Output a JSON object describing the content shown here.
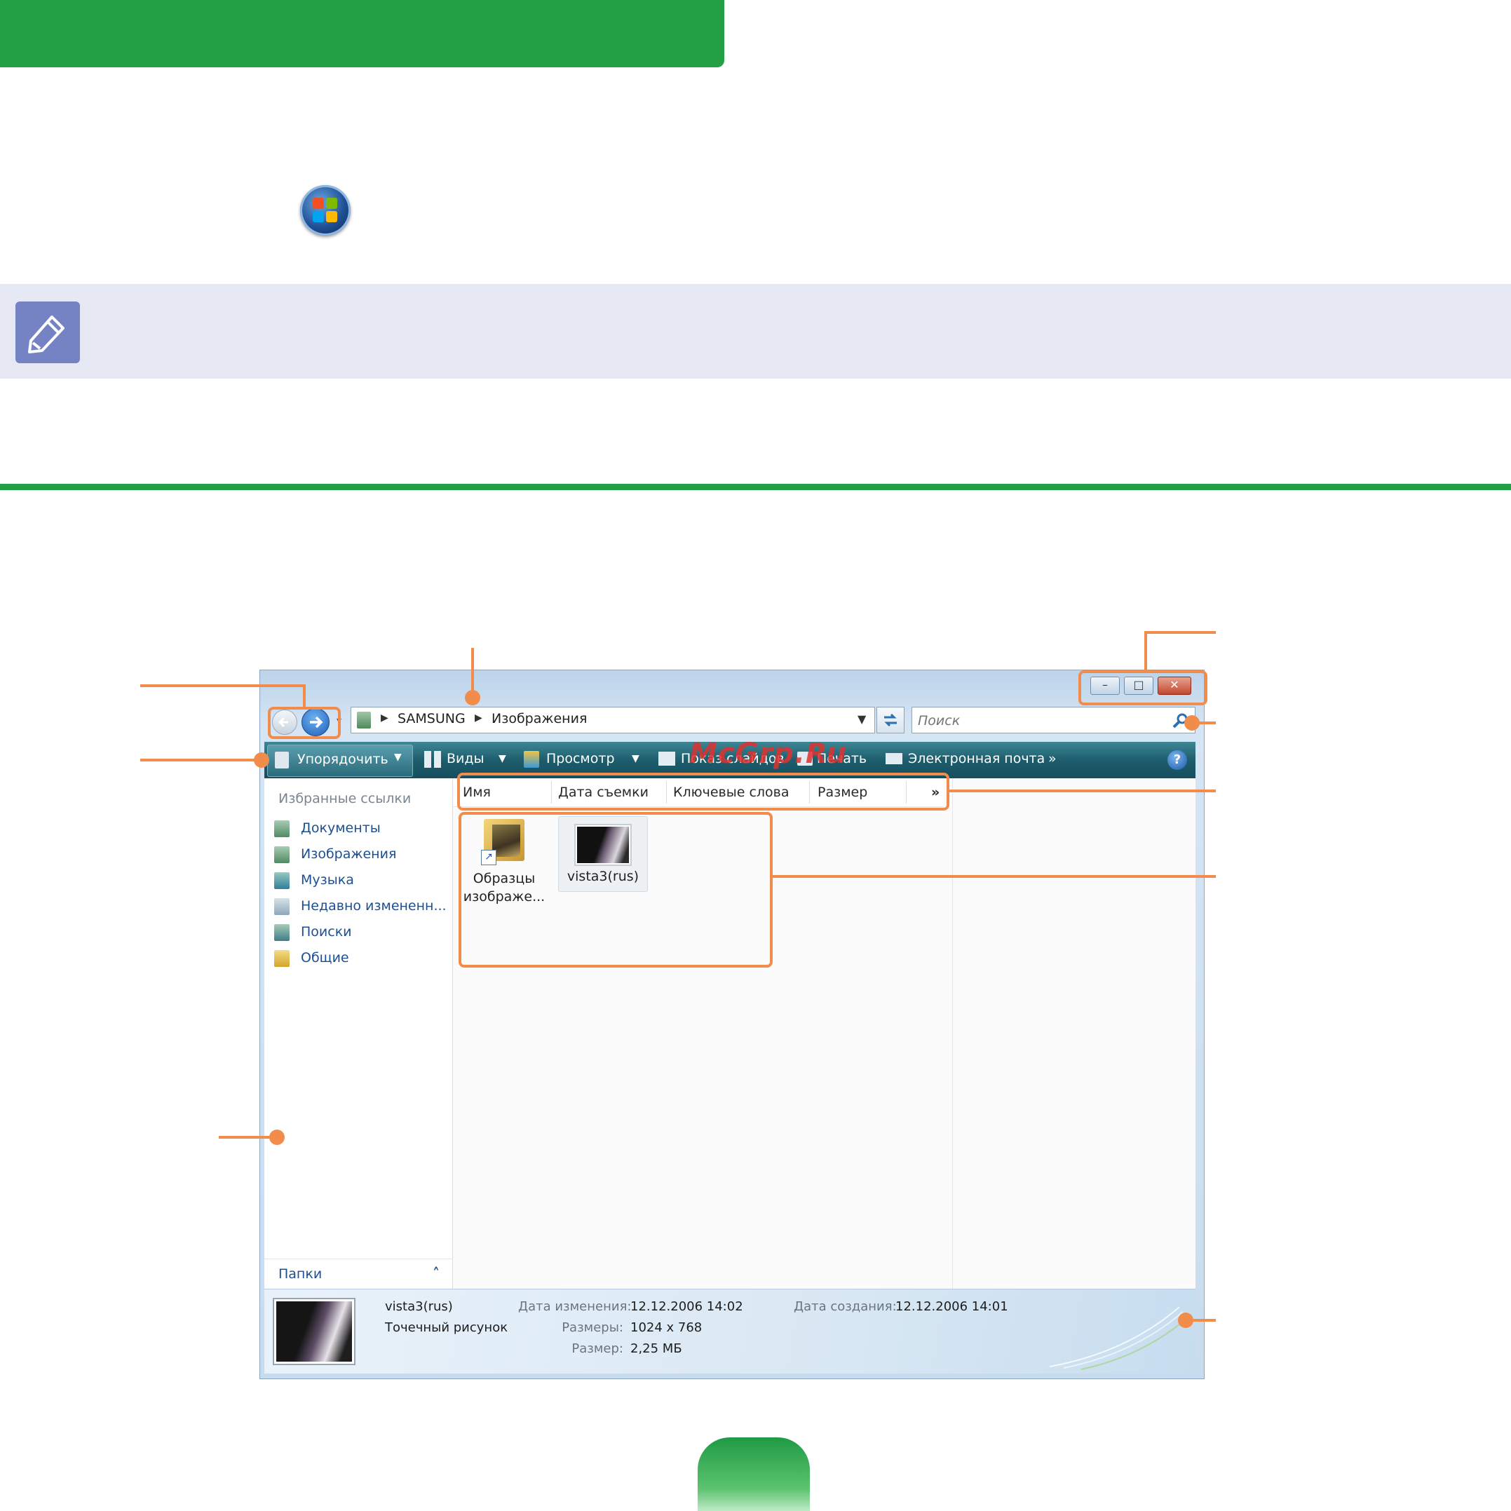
{
  "page": {
    "watermark": "McGrp.Ru"
  },
  "explorer": {
    "address": {
      "crumbs": [
        "SAMSUNG",
        "Изображения"
      ]
    },
    "search": {
      "placeholder": "Поиск"
    },
    "window_buttons": {
      "minimize": "–",
      "maximize": "□",
      "close": "✕"
    },
    "toolbar": {
      "organize": "Упорядочить",
      "views": "Виды",
      "preview": "Просмотр",
      "slideshow": "Показ слайдов",
      "print": "Печать",
      "email": "Электронная почта",
      "more": "»",
      "help": "?"
    },
    "sidebar": {
      "header": "Избранные ссылки",
      "items": [
        {
          "label": "Документы",
          "icon": "documents-icon"
        },
        {
          "label": "Изображения",
          "icon": "pictures-icon"
        },
        {
          "label": "Музыка",
          "icon": "music-icon"
        },
        {
          "label": "Недавно измененн...",
          "icon": "recent-icon"
        },
        {
          "label": "Поиски",
          "icon": "searches-icon"
        },
        {
          "label": "Общие",
          "icon": "public-folder-icon"
        }
      ],
      "folders_label": "Папки"
    },
    "columns": [
      "Имя",
      "Дата съемки",
      "Ключевые слова",
      "Размер",
      "»"
    ],
    "files": [
      {
        "line1": "Образцы",
        "line2": "изображе...",
        "icon": "sample-pictures-shortcut-icon"
      },
      {
        "line1": "vista3(rus)",
        "line2": "",
        "icon": "bitmap-thumbnail-icon"
      }
    ],
    "details": {
      "name": "vista3(rus)",
      "type": "Точечный рисунок",
      "modified_label": "Дата изменения:",
      "modified_value": "12.12.2006 14:02",
      "dimensions_label": "Размеры:",
      "dimensions_value": "1024 x 768",
      "size_label": "Размер:",
      "size_value": "2,25 МБ",
      "created_label": "Дата создания:",
      "created_value": "12.12.2006 14:01"
    }
  },
  "colors": {
    "green": "#23a046",
    "callout": "#f28c4a",
    "note_band": "#e6e9f3",
    "note_icon": "#7582c4",
    "toolbar": "#1d5d6d"
  }
}
